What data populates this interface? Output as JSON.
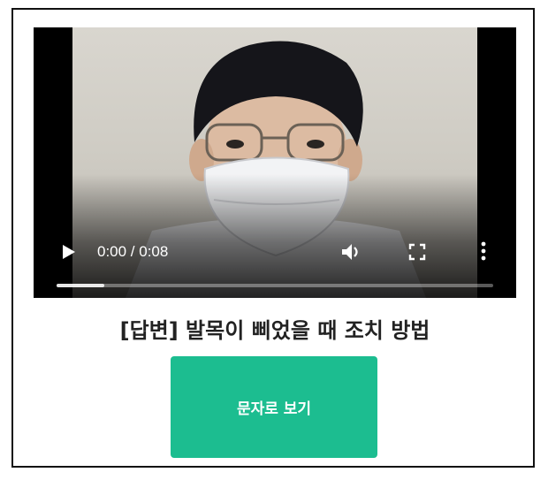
{
  "player": {
    "time_display": "0:00 / 0:08",
    "progress": 0,
    "buffered_fraction": 0.11,
    "icons": [
      "play-icon",
      "volume-icon",
      "fullscreen-icon",
      "more-options-icon"
    ]
  },
  "title": "[답변] 발목이 삐었을 때 조치 방법",
  "button": {
    "label": "문자로 보기",
    "color": "#1cbd90"
  }
}
